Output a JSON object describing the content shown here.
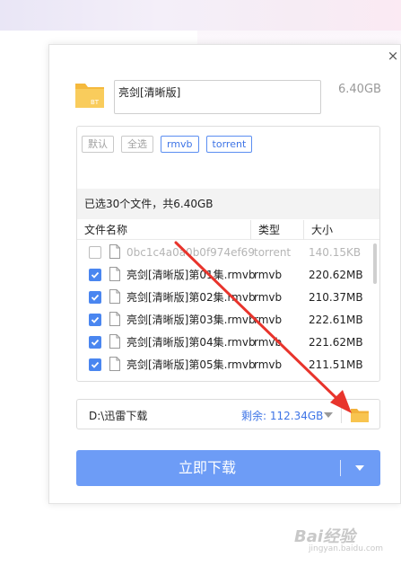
{
  "header": {
    "title_value": "亮剑[清晰版]",
    "total_size": "6.40GB",
    "close_glyph": "×"
  },
  "filters": [
    {
      "label": "默认",
      "active": false
    },
    {
      "label": "全选",
      "active": false
    },
    {
      "label": "rmvb",
      "active": true
    },
    {
      "label": "torrent",
      "active": true
    }
  ],
  "summary": "已选30个文件，共6.40GB",
  "columns": {
    "name": "文件名称",
    "type": "类型",
    "size": "大小"
  },
  "files": [
    {
      "name": "0bc1c4a0a0b0f974ef69...",
      "type": "torrent",
      "size": "140.15KB",
      "checked": false
    },
    {
      "name": "亮剑[清晰版]第01集.rmvb",
      "type": "rmvb",
      "size": "220.62MB",
      "checked": true
    },
    {
      "name": "亮剑[清晰版]第02集.rmvb",
      "type": "rmvb",
      "size": "210.37MB",
      "checked": true
    },
    {
      "name": "亮剑[清晰版]第03集.rmvb",
      "type": "rmvb",
      "size": "222.61MB",
      "checked": true
    },
    {
      "name": "亮剑[清晰版]第04集.rmvb",
      "type": "rmvb",
      "size": "221.62MB",
      "checked": true
    },
    {
      "name": "亮剑[清晰版]第05集.rmvb",
      "type": "rmvb",
      "size": "211.51MB",
      "checked": true
    }
  ],
  "save_path": {
    "path": "D:\\迅雷下载",
    "free_space": "剩余: 112.34GB"
  },
  "download_button": {
    "label": "立即下载"
  },
  "watermark": {
    "text": "Bai经验",
    "sub": "jingyan.baidu.com"
  },
  "icons": {
    "bt": "bt-folder-icon",
    "file": "file-icon",
    "folder": "folder-icon",
    "check": "check-icon"
  },
  "colors": {
    "accent": "#4a86f0",
    "button": "#6d9cf6",
    "folder": "#f8c44f",
    "arrow": "#e8342c"
  }
}
